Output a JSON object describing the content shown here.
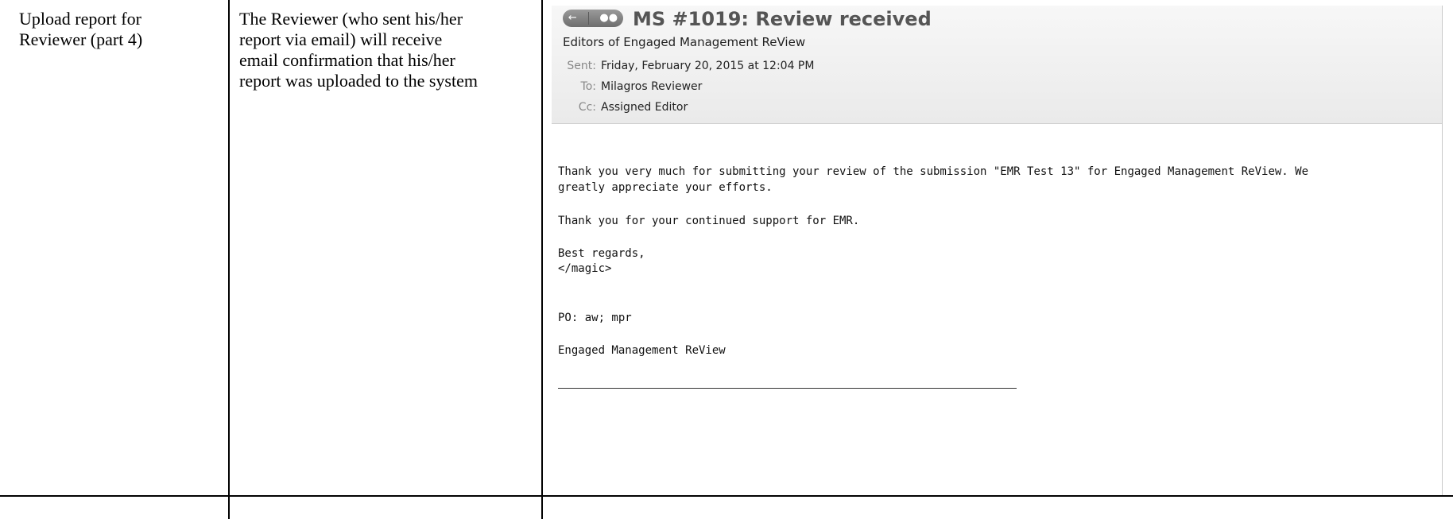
{
  "table": {
    "col1": [
      "Upload report for",
      "Reviewer (part 4)"
    ],
    "col2": [
      "The Reviewer (who sent his/her",
      "report via email) will receive",
      "email confirmation that his/her",
      "report was uploaded to the system"
    ]
  },
  "email": {
    "subject": "MS #1019: Review received",
    "from": "Editors of Engaged Management ReView",
    "sent_label": "Sent:",
    "sent_value": "Friday, February 20, 2015 at 12:04 PM",
    "to_label": "To:",
    "to_value": "Milagros Reviewer",
    "cc_label": "Cc:",
    "cc_value": "Assigned Editor",
    "body": {
      "line1": "Thank you very much for submitting your review of the submission \"EMR Test 13\" for Engaged Management ReView. We",
      "line2": "greatly appreciate your efforts.",
      "line3": "Thank you for your continued support for EMR.",
      "line4": "Best regards,",
      "line5": "</magic>",
      "line6": "PO: aw; mpr",
      "line7": "Engaged Management ReView"
    }
  }
}
